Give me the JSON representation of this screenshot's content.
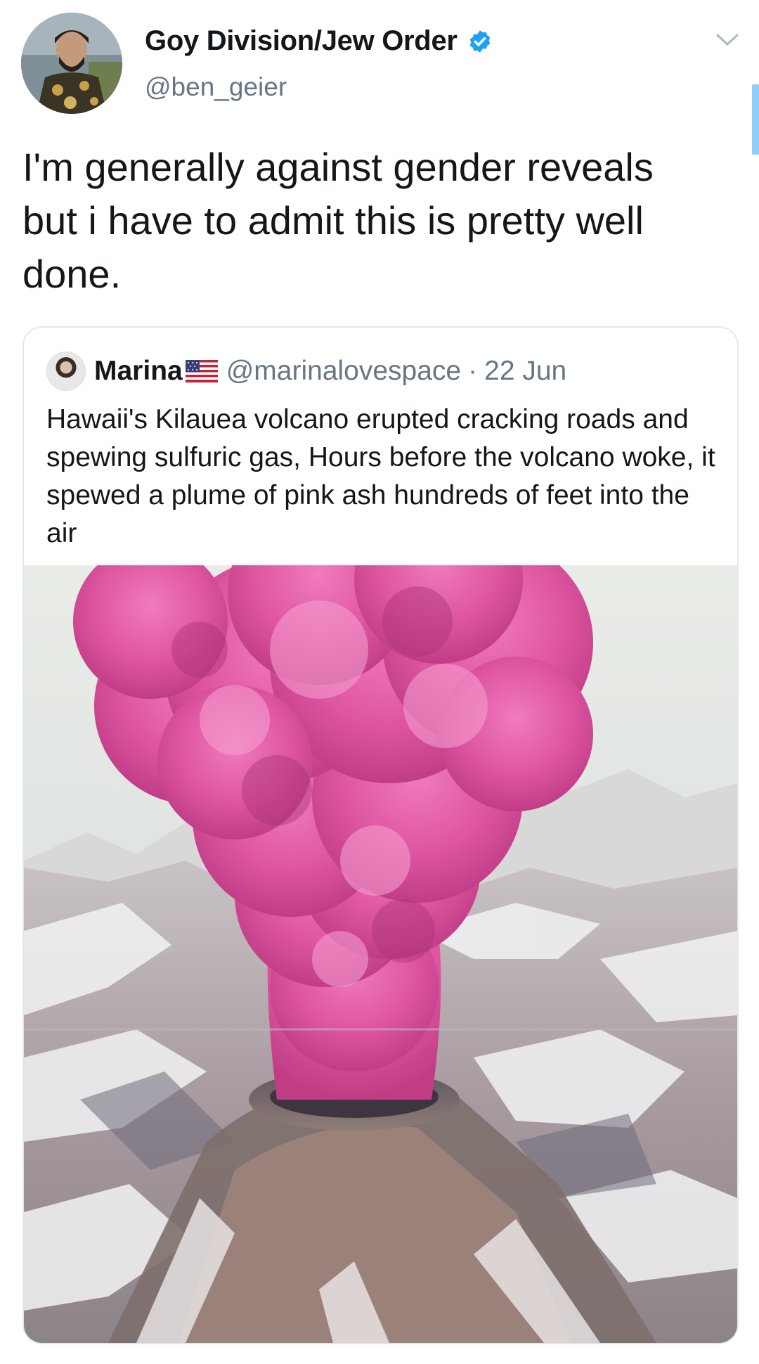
{
  "tweet": {
    "author": {
      "display_name": "Goy Division/Jew Order",
      "handle": "@ben_geier",
      "verified": true
    },
    "text": "I'm generally against gender reveals but i have to admit this is pretty well done."
  },
  "quoted_tweet": {
    "author": {
      "display_name": "Marina",
      "flag": "us-flag-icon",
      "handle": "@marinalovespace"
    },
    "separator": "·",
    "date": "22 Jun",
    "text": "Hawaii's Kilauea volcano erupted cracking roads and spewing sulfuric gas, Hours before the volcano woke, it spewed a plume of pink ash hundreds of feet into the air"
  },
  "icons": {
    "verified": "verified-badge-icon",
    "menu": "chevron-down-icon"
  },
  "colors": {
    "verified": "#1da1f2",
    "secondary_text": "#657786",
    "primary_text": "#14171a",
    "card_border": "#e1e8ed",
    "plume": "#e0559f"
  }
}
